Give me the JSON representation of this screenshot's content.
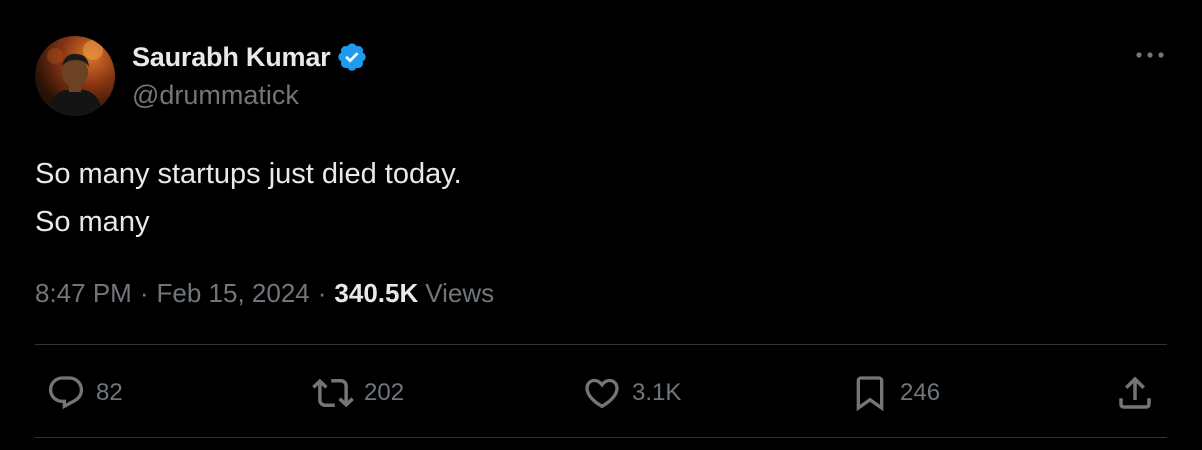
{
  "author": {
    "display_name": "Saurabh Kumar",
    "handle": "@drummatick",
    "verified": true,
    "verified_color": "#1d9bf0"
  },
  "tweet": {
    "text": "So many startups just died today.\nSo many",
    "time": "8:47 PM",
    "separator": "·",
    "date": "Feb 15, 2024",
    "views_count": "340.5K",
    "views_label": "Views"
  },
  "actions": {
    "replies": "82",
    "reposts": "202",
    "likes": "3.1K",
    "bookmarks": "246"
  },
  "icons": {
    "more": "more-horizontal-icon",
    "reply": "reply-icon",
    "repost": "repost-icon",
    "like": "heart-icon",
    "bookmark": "bookmark-icon",
    "share": "share-icon"
  },
  "colors": {
    "background": "#000000",
    "primary_text": "#e7e9ea",
    "secondary_text": "#71767b",
    "divider": "#2f3336"
  }
}
